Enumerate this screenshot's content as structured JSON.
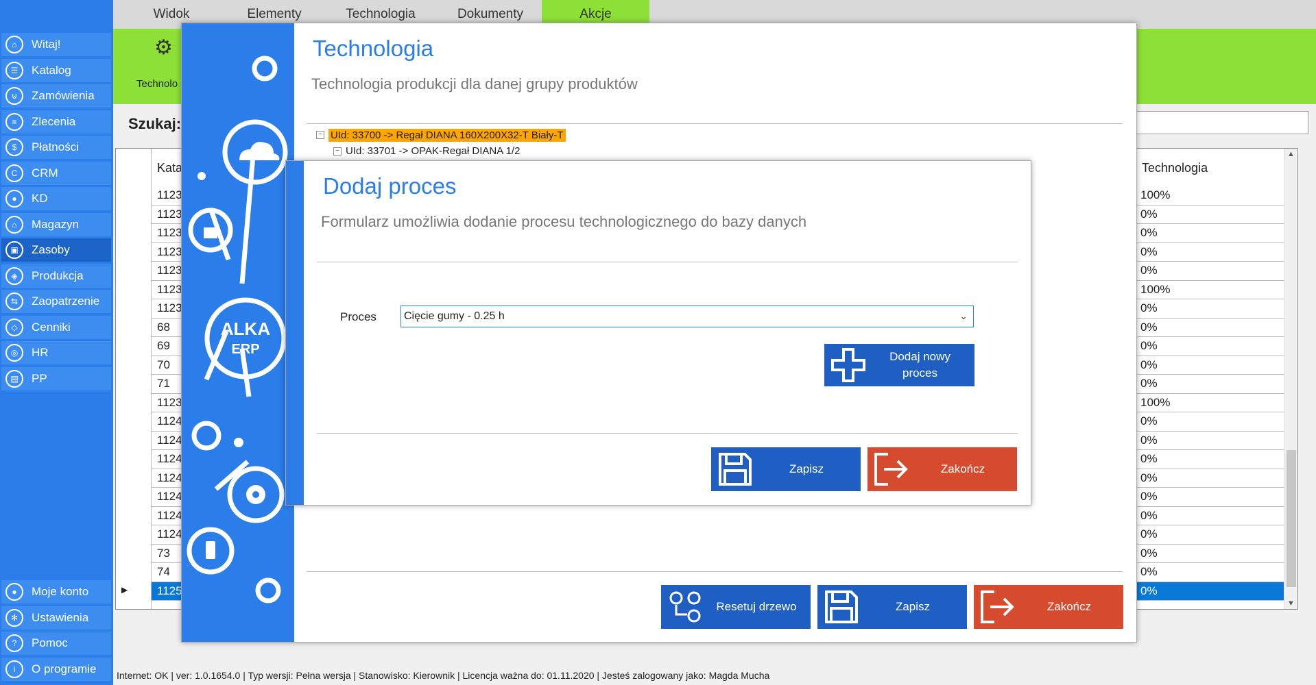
{
  "sidebar": {
    "items": [
      {
        "label": "Witaj!",
        "icon": "home-icon"
      },
      {
        "label": "Katalog",
        "icon": "book-icon"
      },
      {
        "label": "Zamówienia",
        "icon": "cart-icon"
      },
      {
        "label": "Zlecenia",
        "icon": "list-icon"
      },
      {
        "label": "Płatności",
        "icon": "dollar-icon"
      },
      {
        "label": "CRM",
        "icon": "crm-icon"
      },
      {
        "label": "KD",
        "icon": "user-icon"
      },
      {
        "label": "Magazyn",
        "icon": "warehouse-icon"
      },
      {
        "label": "Zasoby",
        "icon": "resources-icon"
      },
      {
        "label": "Produkcja",
        "icon": "production-icon"
      },
      {
        "label": "Zaopatrzenie",
        "icon": "truck-icon"
      },
      {
        "label": "Cenniki",
        "icon": "tag-icon"
      },
      {
        "label": "HR",
        "icon": "hr-icon"
      },
      {
        "label": "PP",
        "icon": "factory-icon"
      }
    ],
    "bottom_items": [
      {
        "label": "Moje konto",
        "icon": "user-icon"
      },
      {
        "label": "Ustawienia",
        "icon": "gear-icon"
      },
      {
        "label": "Pomoc",
        "icon": "help-icon"
      },
      {
        "label": "O programie",
        "icon": "info-icon"
      }
    ]
  },
  "topmenu": {
    "tabs": [
      "Widok",
      "Elementy",
      "Technologia",
      "Dokumenty",
      "Akcje"
    ],
    "ribbon_label": "Technolo"
  },
  "search": {
    "label": "Szukaj:"
  },
  "grid": {
    "col1_header": "Kata",
    "col2_header": "Technologia",
    "rows": [
      [
        "1123",
        "100%"
      ],
      [
        "1123",
        "0%"
      ],
      [
        "1123",
        "0%"
      ],
      [
        "1123",
        "0%"
      ],
      [
        "1123",
        "0%"
      ],
      [
        "1123",
        "100%"
      ],
      [
        "1123",
        "0%"
      ],
      [
        "68",
        "0%"
      ],
      [
        "69",
        "0%"
      ],
      [
        "70",
        "0%"
      ],
      [
        "71",
        "0%"
      ],
      [
        "1123",
        "100%"
      ],
      [
        "1124",
        "0%"
      ],
      [
        "1124",
        "0%"
      ],
      [
        "1124",
        "0%"
      ],
      [
        "1124",
        "0%"
      ],
      [
        "1124",
        "0%"
      ],
      [
        "1124",
        "0%"
      ],
      [
        "1124",
        "0%"
      ],
      [
        "73",
        "0%"
      ],
      [
        "74",
        "0%"
      ],
      [
        "1125",
        "0%"
      ]
    ]
  },
  "statusbar": {
    "text": "Internet: OK  |   ver: 1.0.1654.0   |   Typ wersji: Pełna wersja   |   Stanowisko: Kierownik   |   Licencja ważna do: 01.11.2020   |   Jesteś zalogowany jako: Magda Mucha"
  },
  "dialog_tech": {
    "title": "Technologia",
    "subtitle": "Technologia produkcji dla danej grupy produktów",
    "tree": [
      "UId: 33700 -> Regał DIANA 160X200X32-T Biały-T",
      "UId: 33701 -> OPAK-Regał DIANA   1/2"
    ],
    "logo": "ALKA ERP",
    "buttons": {
      "reset": "Resetuj drzewo",
      "save": "Zapisz",
      "close": "Zakończ"
    }
  },
  "dialog_proces": {
    "title": "Dodaj proces",
    "subtitle": "Formularz umożliwia dodanie procesu technologicznego do bazy danych",
    "field_label": "Proces",
    "field_value": "Cięcie gumy - 0.25 h",
    "buttons": {
      "add": "Dodaj nowy proces",
      "save": "Zapisz",
      "close": "Zakończ"
    }
  },
  "colors": {
    "accent": "#2b7de9",
    "ribbon": "#8de036",
    "danger": "#d64a2e",
    "highlight": "#ffa500"
  }
}
